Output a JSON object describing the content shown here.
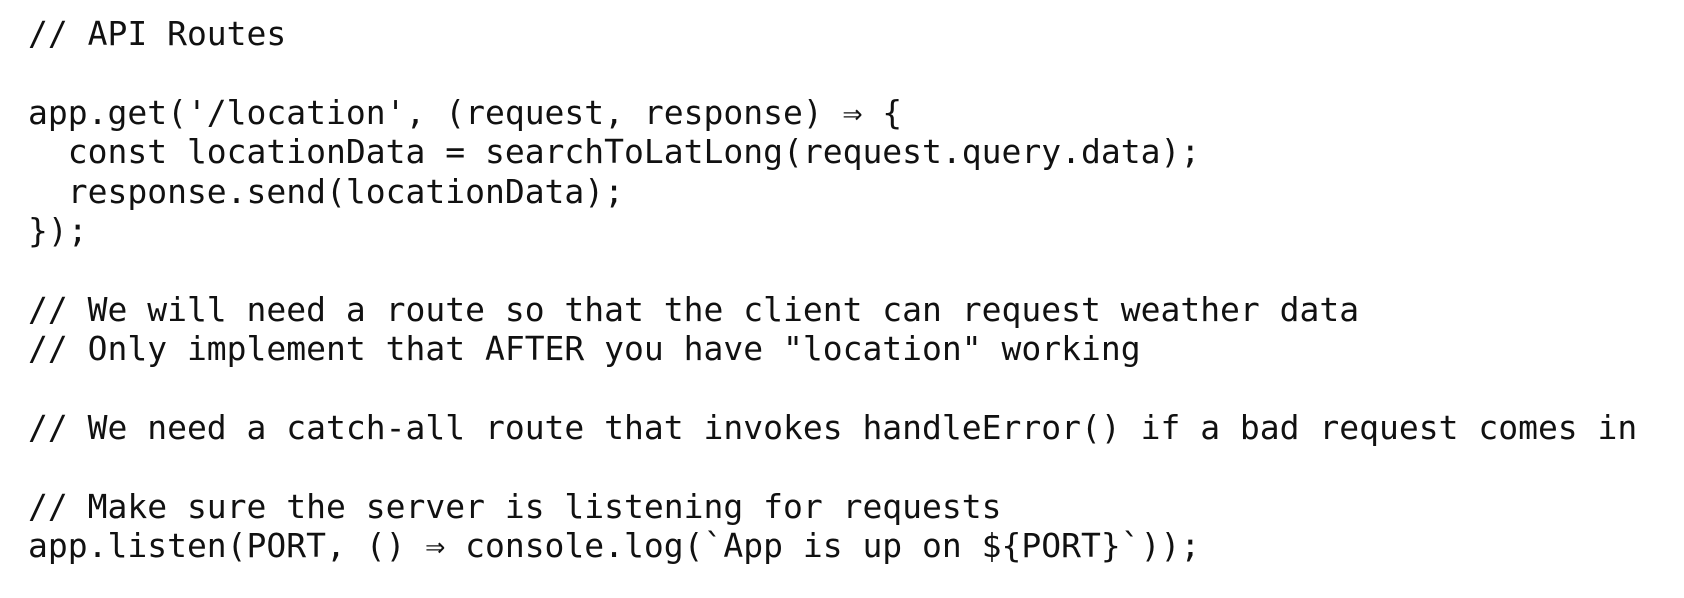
{
  "editor": {
    "lines": [
      "// API Routes",
      "",
      "app.get('/location', (request, response) ⇒ {",
      "  const locationData = searchToLatLong(request.query.data);",
      "  response.send(locationData);",
      "});",
      "",
      "// We will need a route so that the client can request weather data",
      "// Only implement that AFTER you have \"location\" working",
      "",
      "// We need a catch-all route that invokes handleError() if a bad request comes in",
      "",
      "// Make sure the server is listening for requests",
      "app.listen(PORT, () ⇒ console.log(`App is up on ${PORT}`));"
    ]
  }
}
